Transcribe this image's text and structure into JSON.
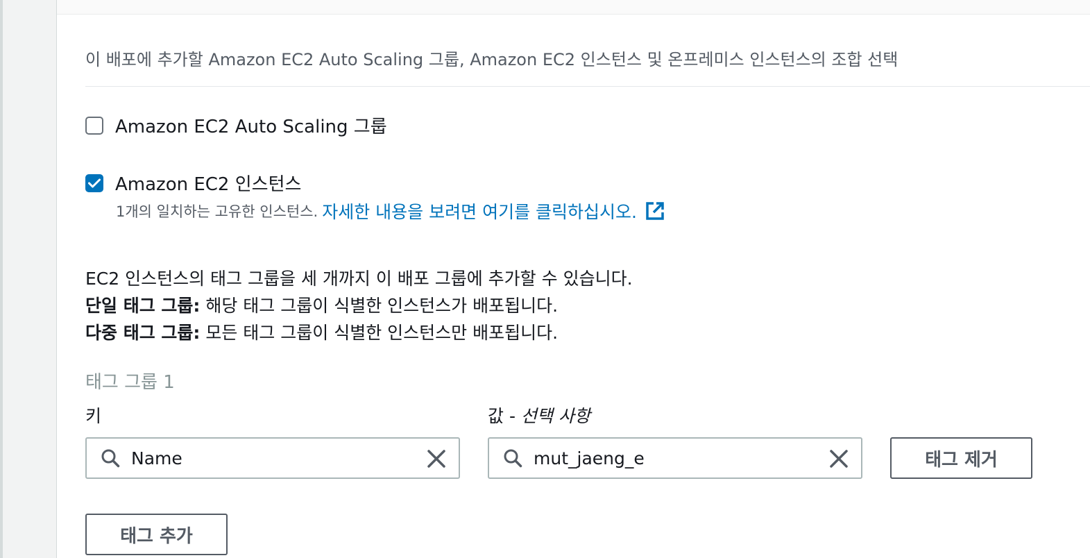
{
  "intro": "이 배포에 추가할 Amazon EC2 Auto Scaling 그룹, Amazon EC2 인스턴스 및 온프레미스 인스턴스의 조합 선택",
  "options": [
    {
      "label": "Amazon EC2 Auto Scaling 그룹",
      "checked": false
    },
    {
      "label": "Amazon EC2 인스턴스",
      "checked": true
    }
  ],
  "ec2_match": {
    "text": "1개의 일치하는 고유한 인스턴스.",
    "link": "자세한 내용을 보려면 여기를 클릭하십시오.",
    "link_icon": "external-link-icon"
  },
  "info": {
    "line1": "EC2 인스턴스의 태그 그룹을 세 개까지 이 배포 그룹에 추가할 수 있습니다.",
    "single_label": "단일 태그 그룹:",
    "single_text": " 해당 태그 그룹이 식별한 인스턴스가 배포됩니다.",
    "multi_label": "다중 태그 그룹:",
    "multi_text": " 모든 태그 그룹이 식별한 인스턴스만 배포됩니다."
  },
  "tag_group": {
    "title": "태그 그룹 1",
    "key_label": "키",
    "value_label": "값 -",
    "value_optional": "선택 사항",
    "key_value": "Name",
    "value_value": "mut_jaeng_e",
    "remove_button": "태그 제거"
  },
  "add_tag_button": "태그 추가",
  "colors": {
    "accent": "#0073bb",
    "border": "#aab7b8",
    "muted": "#545b64"
  }
}
